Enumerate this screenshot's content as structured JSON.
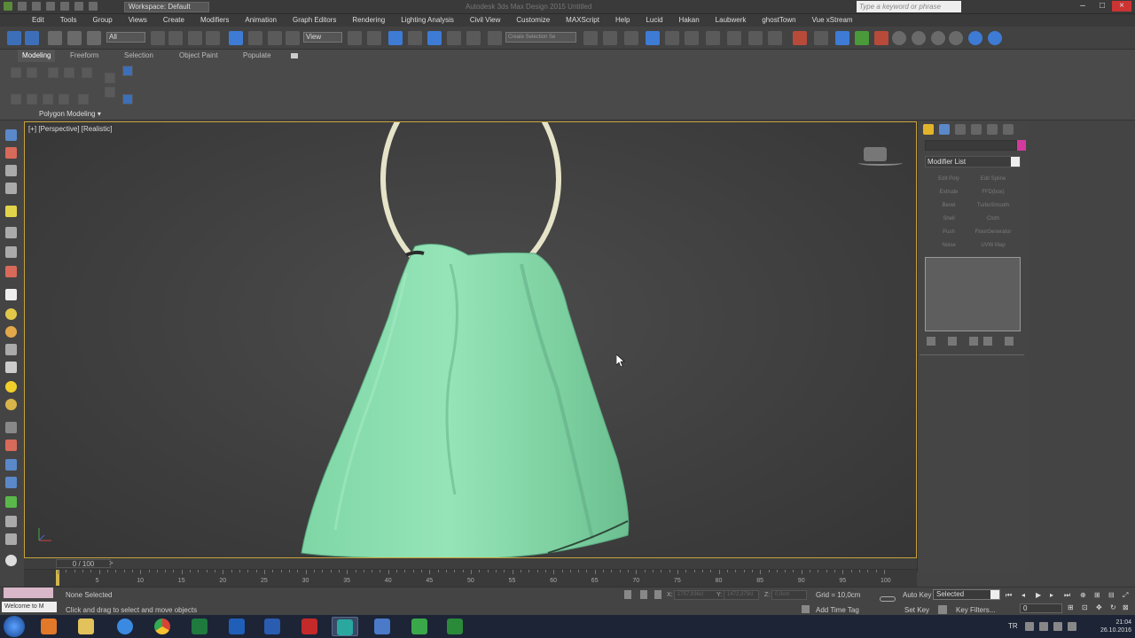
{
  "titlebar": {
    "workspace": "Workspace: Default",
    "app_title": "Autodesk 3ds Max Design 2015    Untitled",
    "search_placeholder": "Type a keyword or phrase"
  },
  "menu": [
    "Edit",
    "Tools",
    "Group",
    "Views",
    "Create",
    "Modifiers",
    "Animation",
    "Graph Editors",
    "Rendering",
    "Lighting Analysis",
    "Civil View",
    "Customize",
    "MAXScript",
    "Help",
    "Lucid",
    "Hakan",
    "Laubwerk",
    "ghostTown",
    "Vue xStream"
  ],
  "toolbar": {
    "selection_filter": "All",
    "ref_coord": "View",
    "named_selection": "Create Selection Se"
  },
  "ribbon": {
    "tabs": [
      "Modeling",
      "Freeform",
      "Selection",
      "Object Paint",
      "Populate"
    ],
    "active_tab": "Modeling",
    "panel_label": "Polygon Modeling ▾"
  },
  "viewport": {
    "label": "[+] [Perspective] [Realistic]",
    "cloth_color": "#8fe0b2",
    "ring_color": "#e6e4c8",
    "border_color": "#c8a23a"
  },
  "command_panel": {
    "modifier_list": "Modifier List",
    "modifiers": [
      [
        "Edit Poly",
        "Edit Spline"
      ],
      [
        "Extrude",
        "FFD(box)"
      ],
      [
        "Bevel",
        "TurboSmooth"
      ],
      [
        "Shell",
        "Cloth"
      ],
      [
        "Push",
        "FloorGenerator"
      ],
      [
        "Noise",
        "UVW Map"
      ]
    ]
  },
  "timeline": {
    "frame_display": "0 / 100",
    "next": ">",
    "ticks": [
      "0",
      "5",
      "10",
      "15",
      "20",
      "25",
      "30",
      "35",
      "40",
      "45",
      "50",
      "55",
      "60",
      "65",
      "70",
      "75",
      "80",
      "85",
      "90",
      "95",
      "100"
    ]
  },
  "status": {
    "welcome": "Welcome to M",
    "selection": "None Selected",
    "prompt": "Click and drag to select and move objects",
    "x_label": "X:",
    "x_value": "1757,836cl",
    "y_label": "Y:",
    "y_value": "1472,379cl",
    "z_label": "Z:",
    "z_value": "0,0cm",
    "grid": "Grid = 10,0cm",
    "add_time_tag": "Add Time Tag",
    "auto_key": "Auto Key",
    "selected": "Selected",
    "set_key": "Set Key",
    "key_filters": "Key Filters...",
    "frame": "0"
  },
  "taskbar": {
    "lang": "TR",
    "time": "21:04",
    "date": "26.10.2016"
  }
}
